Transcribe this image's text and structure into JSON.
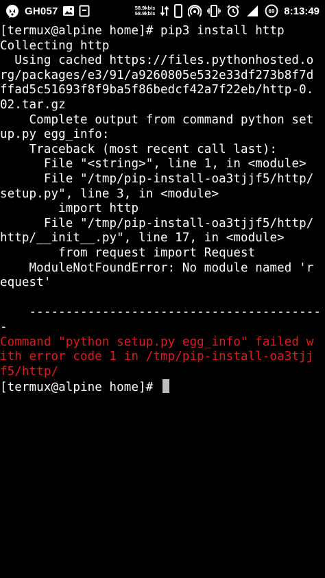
{
  "status_bar": {
    "carrier": "GH057",
    "net_speed_up": "58.9kb/s",
    "net_speed_down": "58.9kb/s",
    "time": "8:13:49",
    "battery_level": "69",
    "icons": [
      "app-logo-icon",
      "image-icon",
      "sd-card-icon",
      "data-transfer-icon",
      "phone-icon",
      "hotspot-icon",
      "vibrate-icon",
      "alarm-icon",
      "signal-icon",
      "battery-icon"
    ]
  },
  "terminal": {
    "colors": {
      "text": "#ffffff",
      "error": "#e01b1b",
      "background": "#000000",
      "cursor": "#bdbdbd"
    },
    "lines": [
      {
        "text": "[termux@alpine home]# pip3 install http",
        "type": "normal"
      },
      {
        "text": "Collecting http",
        "type": "normal"
      },
      {
        "text": "  Using cached https://files.pythonhosted.o",
        "type": "normal"
      },
      {
        "text": "rg/packages/e3/91/a9260805e532e33df273b8f7d",
        "type": "normal"
      },
      {
        "text": "ffad5c51693f8f9ba5f86bedcf42a7f22eb/http-0.",
        "type": "normal"
      },
      {
        "text": "02.tar.gz",
        "type": "normal"
      },
      {
        "text": "    Complete output from command python set",
        "type": "normal"
      },
      {
        "text": "up.py egg_info:",
        "type": "normal"
      },
      {
        "text": "    Traceback (most recent call last):",
        "type": "normal"
      },
      {
        "text": "      File \"<string>\", line 1, in <module>",
        "type": "normal"
      },
      {
        "text": "      File \"/tmp/pip-install-oa3tjjf5/http/",
        "type": "normal"
      },
      {
        "text": "setup.py\", line 3, in <module>",
        "type": "normal"
      },
      {
        "text": "        import http",
        "type": "normal"
      },
      {
        "text": "      File \"/tmp/pip-install-oa3tjjf5/http/",
        "type": "normal"
      },
      {
        "text": "http/__init__.py\", line 17, in <module>",
        "type": "normal"
      },
      {
        "text": "        from request import Request",
        "type": "normal"
      },
      {
        "text": "    ModuleNotFoundError: No module named 'r",
        "type": "normal"
      },
      {
        "text": "equest'",
        "type": "normal"
      },
      {
        "text": "",
        "type": "normal"
      },
      {
        "text": "    ----------------------------------------",
        "type": "normal"
      },
      {
        "text": "-",
        "type": "normal"
      },
      {
        "text": "Command \"python setup.py egg_info\" failed w",
        "type": "error"
      },
      {
        "text": "ith error code 1 in /tmp/pip-install-oa3tjj",
        "type": "error"
      },
      {
        "text": "f5/http/",
        "type": "error"
      }
    ],
    "prompt": "[termux@alpine home]# "
  }
}
